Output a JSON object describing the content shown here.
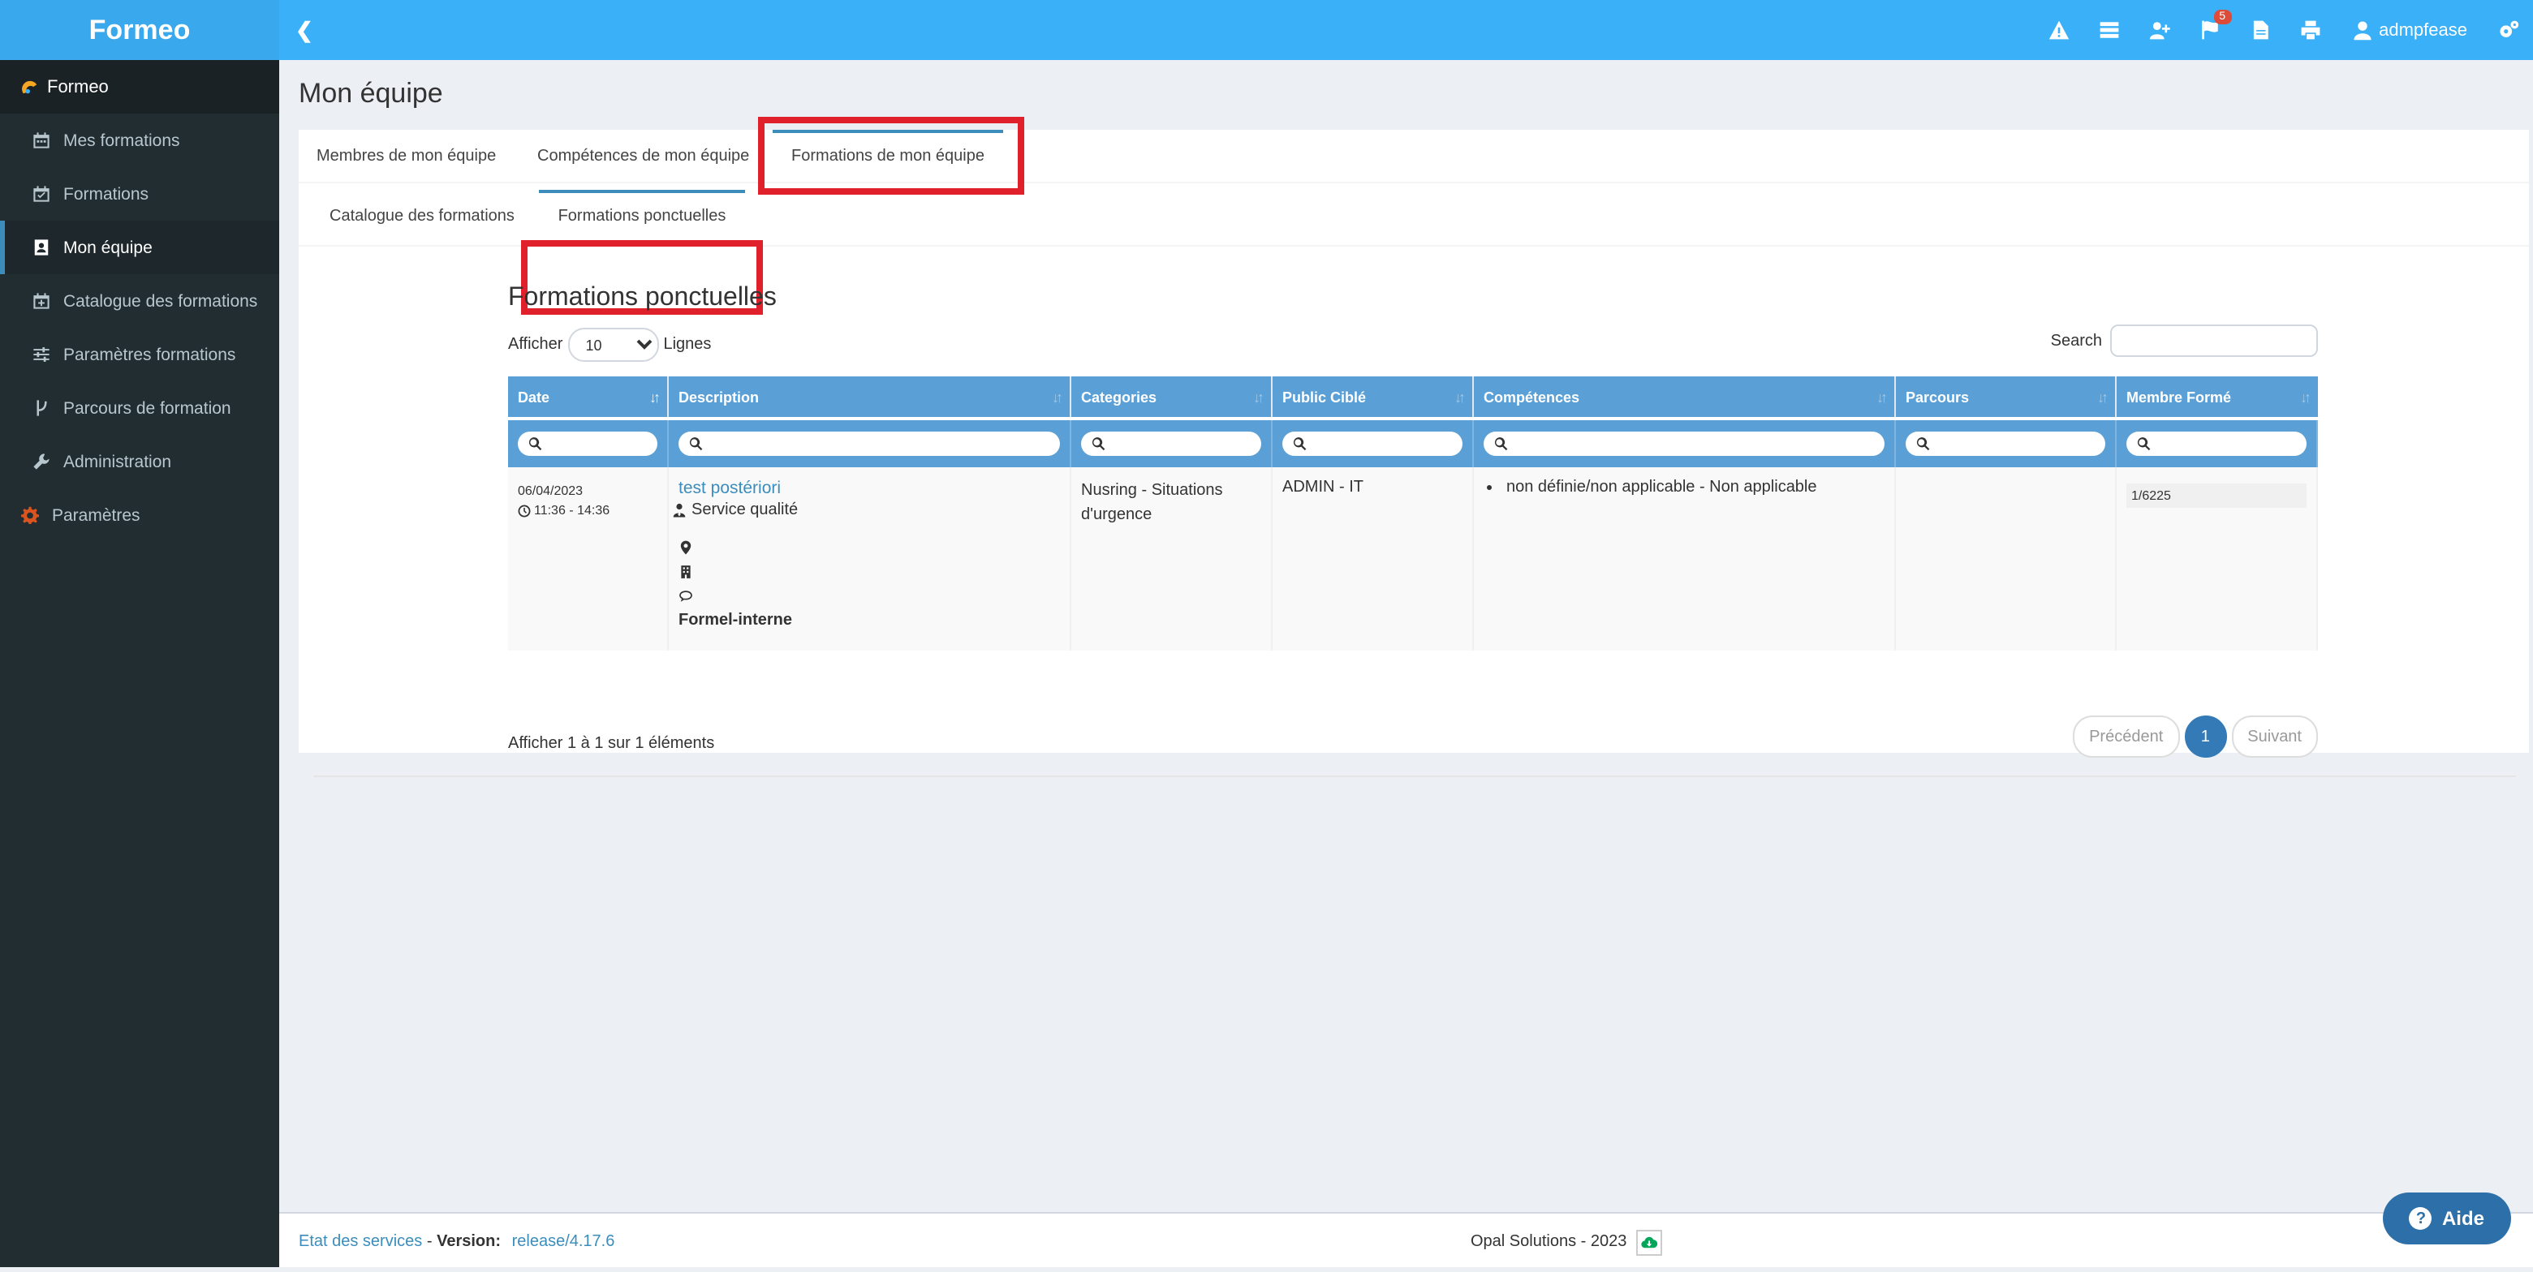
{
  "app": {
    "brand": "Formeo"
  },
  "topbar": {
    "toggle_icon": "chevron-left",
    "icons": [
      "warning-icon",
      "list-icon",
      "user-plus-icon",
      "flag-icon",
      "file-icon",
      "print-icon"
    ],
    "notifications_count": "5",
    "user": "admpfease",
    "settings_icon": "cogs-icon"
  },
  "sidebar": {
    "brand": "Formeo",
    "items": [
      {
        "label": "Mes formations",
        "icon": "calendar-icon"
      },
      {
        "label": "Formations",
        "icon": "calendar-check-icon"
      },
      {
        "label": "Mon équipe",
        "icon": "contact-icon",
        "active": true
      },
      {
        "label": "Catalogue des formations",
        "icon": "calendar-plus-icon"
      },
      {
        "label": "Paramètres formations",
        "icon": "sliders-icon"
      },
      {
        "label": "Parcours de formation",
        "icon": "branch-icon"
      },
      {
        "label": "Administration",
        "icon": "wrench-icon"
      },
      {
        "label": "Paramètres",
        "icon": "gear-icon"
      }
    ]
  },
  "page": {
    "title": "Mon équipe"
  },
  "tabs_primary": [
    "Membres de mon équipe",
    "Compétences de mon équipe",
    "Formations de mon équipe"
  ],
  "tabs_secondary": [
    "Catalogue des formations",
    "Formations ponctuelles"
  ],
  "panel": {
    "title": "Formations ponctuelles",
    "show_label": "Afficher",
    "page_length": "10",
    "lines_label": "Lignes",
    "search_label": "Search"
  },
  "table": {
    "headers": [
      "Date",
      "Description",
      "Categories",
      "Public Ciblé",
      "Compétences",
      "Parcours",
      "Membre Formé"
    ],
    "rows": [
      {
        "date": "06/04/2023",
        "time": "11:36 - 14:36",
        "title": "test postériori",
        "service": "Service qualité",
        "mode": "Formel-interne",
        "category": "Nusring - Situations d'urgence",
        "public": "ADMIN - IT",
        "competence": "non définie/non applicable - Non applicable",
        "parcours": "",
        "member": "1/6225"
      }
    ]
  },
  "pagination": {
    "info": "Afficher 1 à 1 sur 1 éléments",
    "prev": "Précédent",
    "current": "1",
    "next": "Suivant"
  },
  "footer": {
    "status_link": "Etat des services",
    "version_label": "Version:",
    "version": "release/4.17.6",
    "copyright": "Opal Solutions - 2023",
    "help": "Aide"
  },
  "colors": {
    "header": "#3ab0f8",
    "sidebar": "#222d32",
    "table_header": "#5aa0d6",
    "highlight": "#e0202a"
  }
}
